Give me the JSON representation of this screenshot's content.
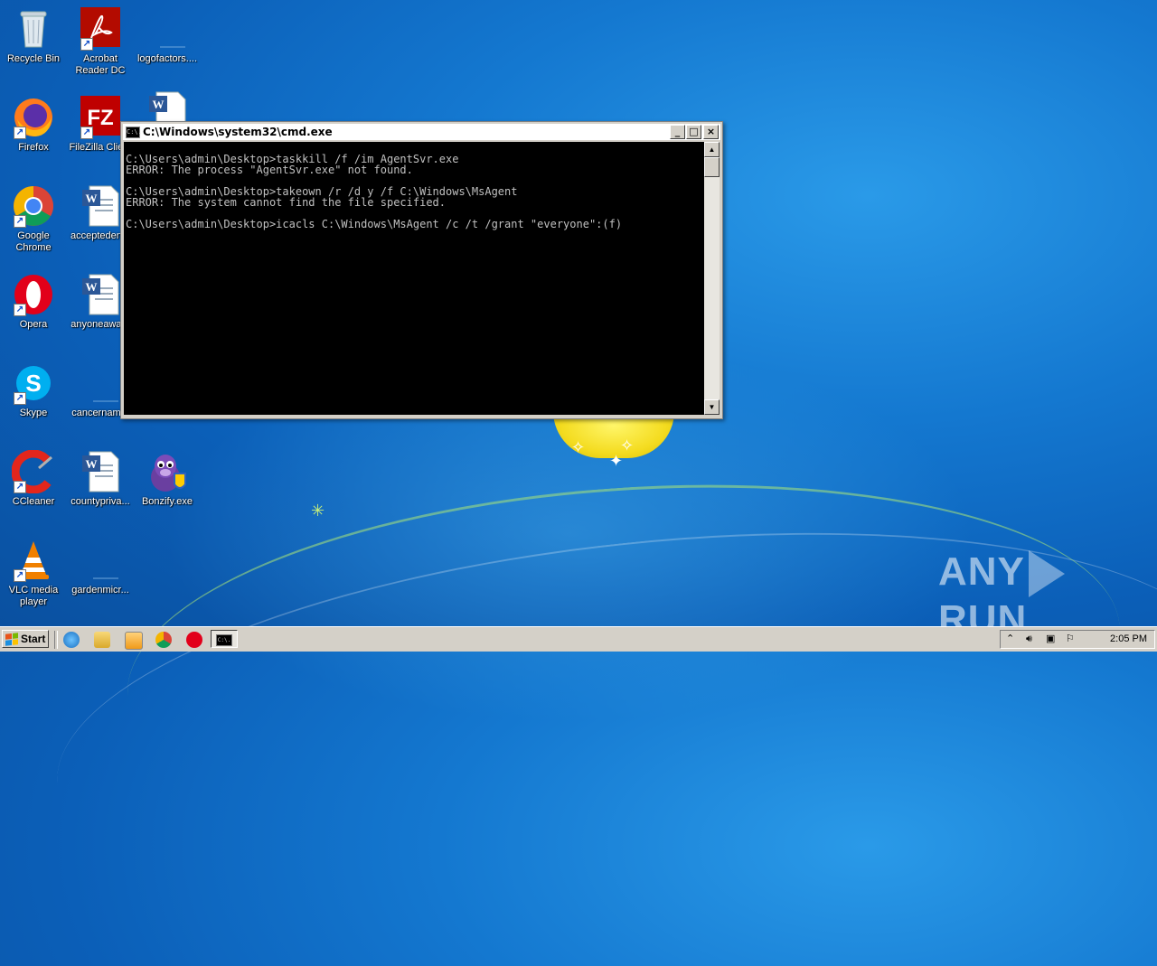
{
  "desktop": {
    "icons": [
      {
        "label": "Recycle Bin"
      },
      {
        "label": "Acrobat Reader DC"
      },
      {
        "label": "logofactors...."
      },
      {
        "label": "Firefox"
      },
      {
        "label": "FileZilla Clie..."
      },
      {
        "label": "Google Chrome"
      },
      {
        "label": "accepteden..."
      },
      {
        "label": "Opera"
      },
      {
        "label": "anyoneawa..."
      },
      {
        "label": "Skype"
      },
      {
        "label": "cancernam..."
      },
      {
        "label": "CCleaner"
      },
      {
        "label": "countypriva..."
      },
      {
        "label": "Bonzify.exe"
      },
      {
        "label": "VLC media player"
      },
      {
        "label": "gardenmicr..."
      }
    ]
  },
  "cmd": {
    "title": "C:\\Windows\\system32\\cmd.exe",
    "icon_text": "C:\\.",
    "min_label": "_",
    "max_label": "□",
    "close_label": "×",
    "output": "C:\\Users\\admin\\Desktop>taskkill /f /im AgentSvr.exe\nERROR: The process \"AgentSvr.exe\" not found.\n\nC:\\Users\\admin\\Desktop>takeown /r /d y /f C:\\Windows\\MsAgent\nERROR: The system cannot find the file specified.\n\nC:\\Users\\admin\\Desktop>icacls C:\\Windows\\MsAgent /c /t /grant \"everyone\":(f)"
  },
  "taskbar": {
    "start_label": "Start",
    "task_icon_text": "C:\\.",
    "clock": "2:05 PM"
  },
  "watermark": {
    "left": "ANY",
    "right": "RUN"
  }
}
